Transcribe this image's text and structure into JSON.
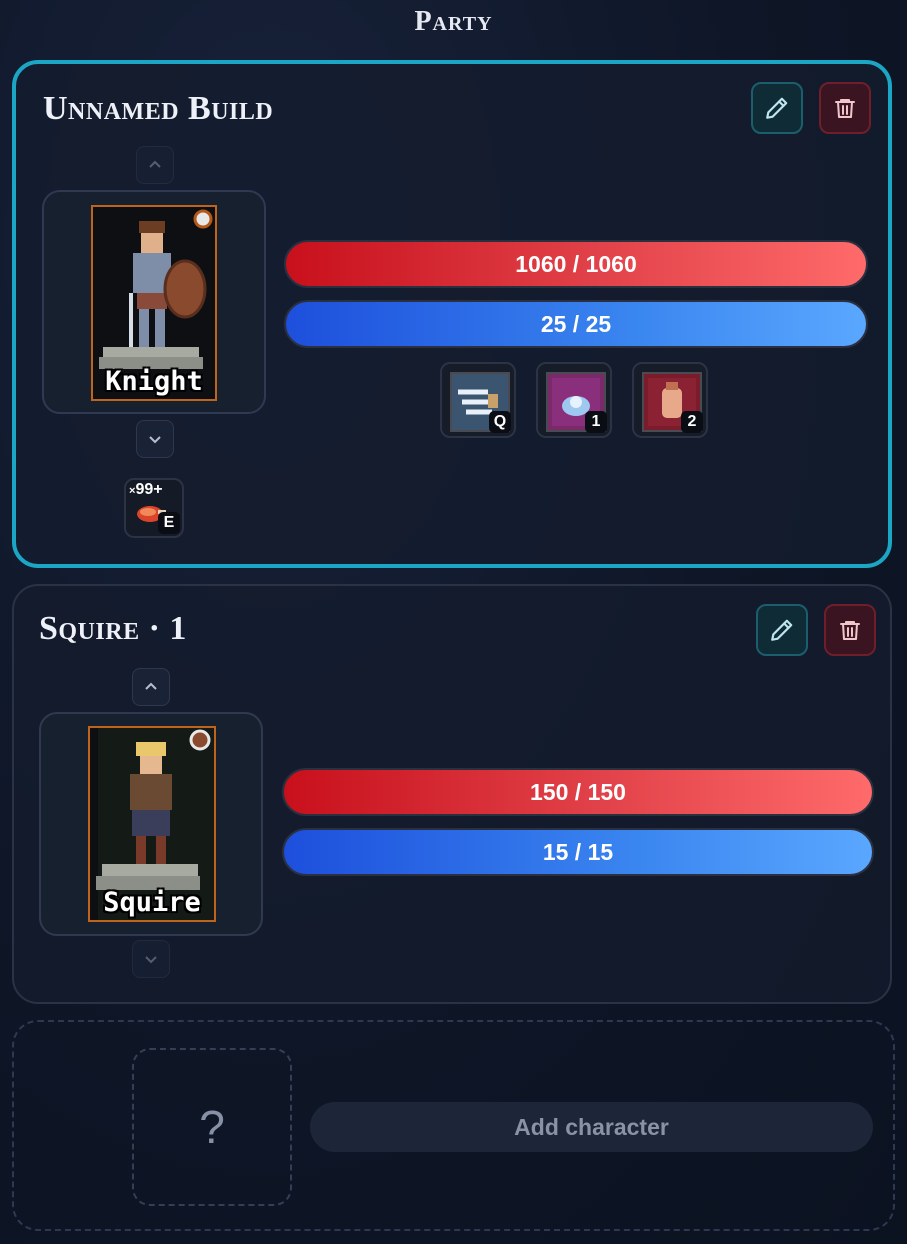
{
  "header": {
    "title": "Party"
  },
  "party": [
    {
      "name": "Unnamed Build",
      "class_label": "Knight",
      "hp": "1060 / 1060",
      "mp": "25 / 25",
      "skills": [
        {
          "icon": "wind-slash-skill-icon",
          "key": "Q"
        },
        {
          "icon": "ice-burst-skill-icon",
          "key": "1"
        },
        {
          "icon": "fist-strike-skill-icon",
          "key": "2"
        }
      ],
      "item": {
        "icon": "meat-item-icon",
        "count": "99+",
        "count_prefix": "×",
        "key": "E"
      }
    },
    {
      "name": "Squire · 1",
      "class_label": "Squire",
      "hp": "150 / 150",
      "mp": "15 / 15"
    }
  ],
  "empty_slot": {
    "placeholder": "?",
    "add_label": "Add character"
  },
  "colors": {
    "accent": "#1aa6c4",
    "hp": "#e2434a",
    "mp": "#3a86f0",
    "portrait_border": "#c0641a"
  }
}
